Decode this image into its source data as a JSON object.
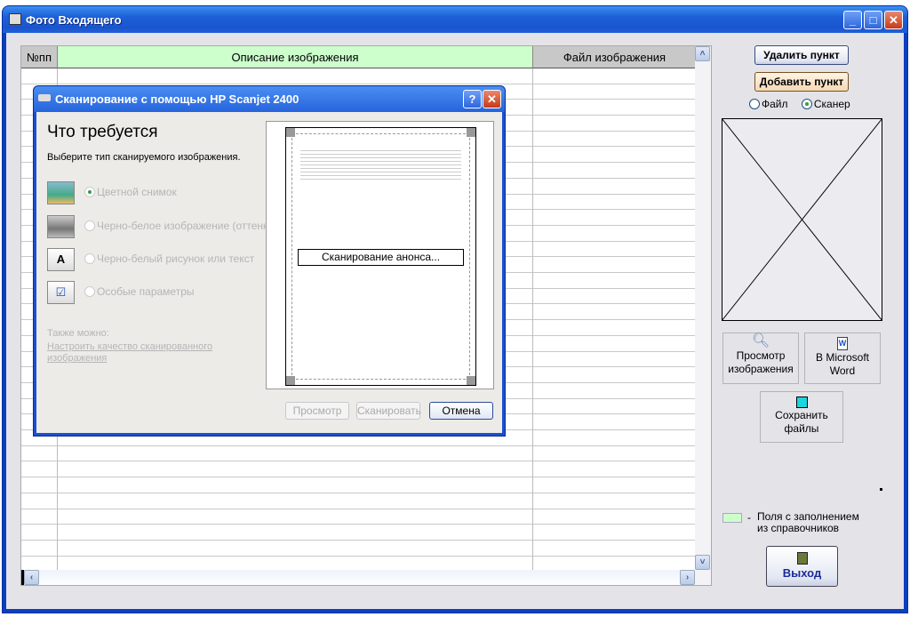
{
  "window": {
    "title": "Фото Входящего",
    "minimize": "_",
    "maximize": "□",
    "close": "✕"
  },
  "grid": {
    "columns": [
      "№пп",
      "Описание изображения",
      "Файл изображения"
    ],
    "header_color": "#ccffcc"
  },
  "side": {
    "delete_item": "Удалить пункт",
    "add_item": "Добавить пункт",
    "source_file": "Файл",
    "source_scanner": "Сканер",
    "selected_source": "scanner",
    "preview_line1": "Просмотр",
    "preview_line2": "изображения",
    "word_line1": "В Microsoft",
    "word_line2": "Word",
    "save_line1": "Сохранить",
    "save_line2": "файлы",
    "legend_dash": "-",
    "legend_line1": "Поля с заполнением",
    "legend_line2": "из справочников",
    "legend_color": "#ccffcc",
    "exit": "Выход"
  },
  "dialog": {
    "title": "Сканирование с помощью HP Scanjet 2400",
    "help": "?",
    "close": "✕",
    "heading": "Что требуется",
    "subheading": "Выберите тип сканируемого изображения.",
    "options": [
      "Цветной снимок",
      "Черно-белое изображение (оттенки",
      "Черно-белый рисунок или текст",
      "Особые параметры"
    ],
    "also": "Также можно:",
    "link": "Настроить качество сканированного изображения",
    "status": "Сканирование анонса...",
    "preview": "Просмотр",
    "scan": "Сканировать",
    "cancel": "Отмена"
  }
}
